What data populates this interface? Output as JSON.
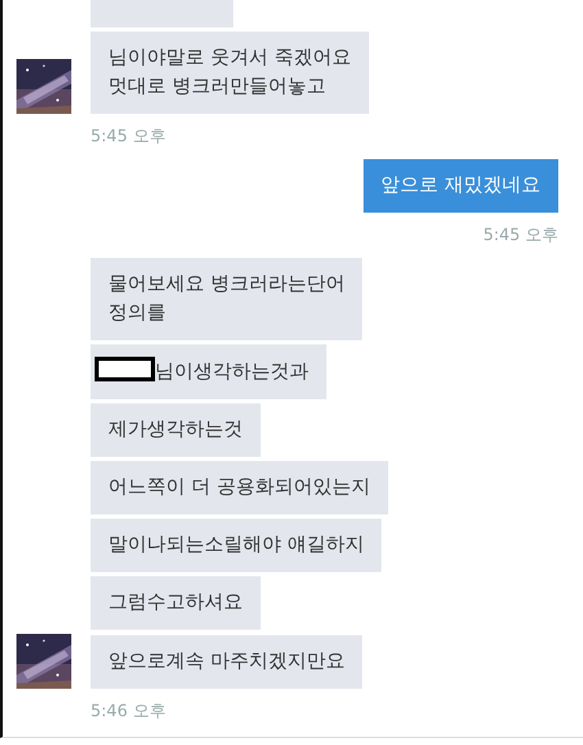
{
  "groups": [
    {
      "outgoing": false,
      "time": "5:45 오후",
      "messages": [
        {
          "kind": "cut"
        },
        {
          "kind": "text",
          "text": "님이야말로 웃겨서 죽겠어요\n멋대로 병크러만들어놓고"
        }
      ]
    },
    {
      "outgoing": true,
      "time": "5:45 오후",
      "messages": [
        {
          "kind": "text",
          "text": "앞으로 재밌겠네요"
        }
      ]
    },
    {
      "outgoing": false,
      "time": "5:46 오후",
      "messages": [
        {
          "kind": "text",
          "text": "물어보세요 병크러라는단어\n정의를"
        },
        {
          "kind": "text",
          "text": "님이생각하는것과",
          "redacted": true
        },
        {
          "kind": "text",
          "text": "제가생각하는것"
        },
        {
          "kind": "text",
          "text": "어느쪽이 더 공용화되어있는지"
        },
        {
          "kind": "text",
          "text": "말이나되는소릴해야 얘길하지"
        },
        {
          "kind": "text",
          "text": "그럼수고하셔요"
        },
        {
          "kind": "text",
          "text": "앞으로계속 마주치겠지만요"
        }
      ]
    }
  ]
}
